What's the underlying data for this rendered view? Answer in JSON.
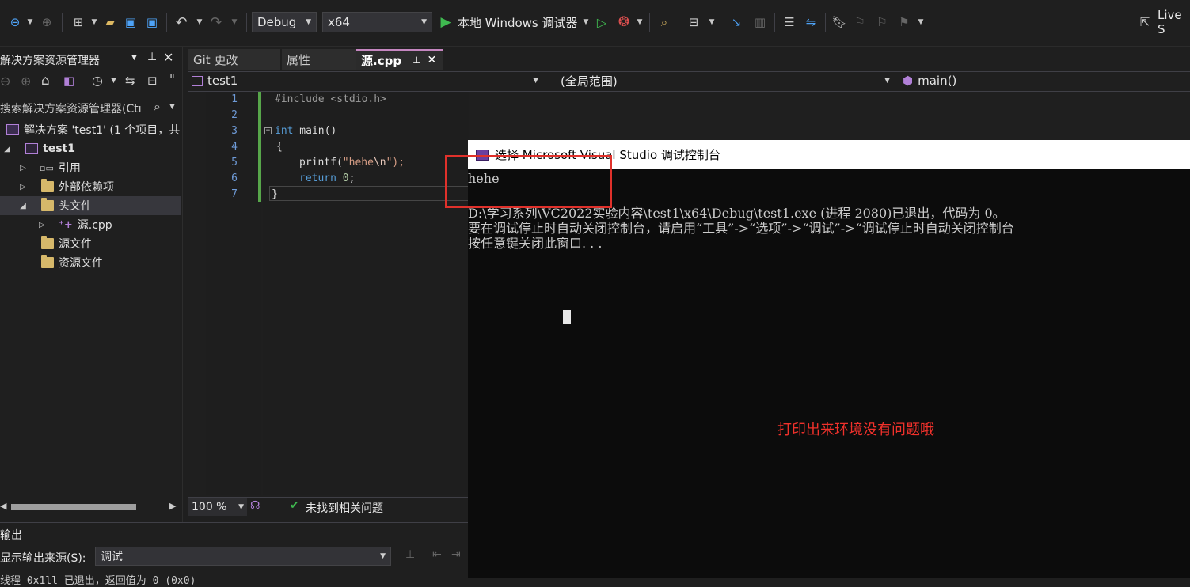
{
  "toolbar": {
    "config": "Debug",
    "platform": "x64",
    "run_label": "本地 Windows 调试器",
    "live_share": "Live S"
  },
  "solution_explorer": {
    "title": "解决方案资源管理器",
    "search_placeholder": "搜索解决方案资源管理器(Ctı",
    "items": [
      {
        "label": "解决方案 'test1' (1 个项目，共",
        "level": 0,
        "icon": "solution-icon"
      },
      {
        "label": "test1",
        "level": 0,
        "icon": "project-icon"
      },
      {
        "label": "引用",
        "level": 1,
        "icon": "references-icon"
      },
      {
        "label": "外部依赖项",
        "level": 1,
        "icon": "folder-icon"
      },
      {
        "label": "头文件",
        "level": 1,
        "icon": "folder-icon"
      },
      {
        "label": "源.cpp",
        "level": 2,
        "icon": "cpp-file-icon"
      },
      {
        "label": "源文件",
        "level": 1,
        "icon": "folder-icon"
      },
      {
        "label": "资源文件",
        "level": 1,
        "icon": "folder-icon"
      }
    ]
  },
  "editor": {
    "tabs": [
      {
        "label": "Git 更改"
      },
      {
        "label": "属性"
      },
      {
        "label": "源.cpp"
      }
    ],
    "nav": {
      "project": "test1",
      "scope": "(全局范围)",
      "member": "main()"
    },
    "line_numbers": [
      "1",
      "2",
      "3",
      "4",
      "5",
      "6",
      "7"
    ],
    "code": {
      "line1": "#include <stdio.h>",
      "line3_kw": "int",
      "line3_rest": " main()",
      "line4": "{",
      "line5_fn": "printf(",
      "line5_str": "\"hehe",
      "line5_esc": "\\n",
      "line5_end": "\");",
      "line6_kw": "return",
      "line6_num": "0",
      "line7": "}"
    },
    "status": {
      "zoom": "100 %",
      "issues": "未找到相关问题"
    }
  },
  "output": {
    "title": "输出",
    "source_label": "显示输出来源(S):",
    "source_value": "调试",
    "last_line": "线程 0x1ll 已退出，返回值为 0 (0x0)"
  },
  "console": {
    "title": "选择 Microsoft Visual Studio 调试控制台",
    "lines": [
      "hehe",
      "",
      "D:\\学习系列\\VC2022实验内容\\test1\\x64\\Debug\\test1.exe (进程 2080)已退出，代码为 0。",
      "要在调试停止时自动关闭控制台，请启用“工具”->“选项”->“调试”->“调试停止时自动关闭控制台",
      "按任意键关闭此窗口. . ."
    ]
  },
  "annotation": {
    "text": "打印出来环境没有问题哦",
    "color": "#f0312b"
  }
}
